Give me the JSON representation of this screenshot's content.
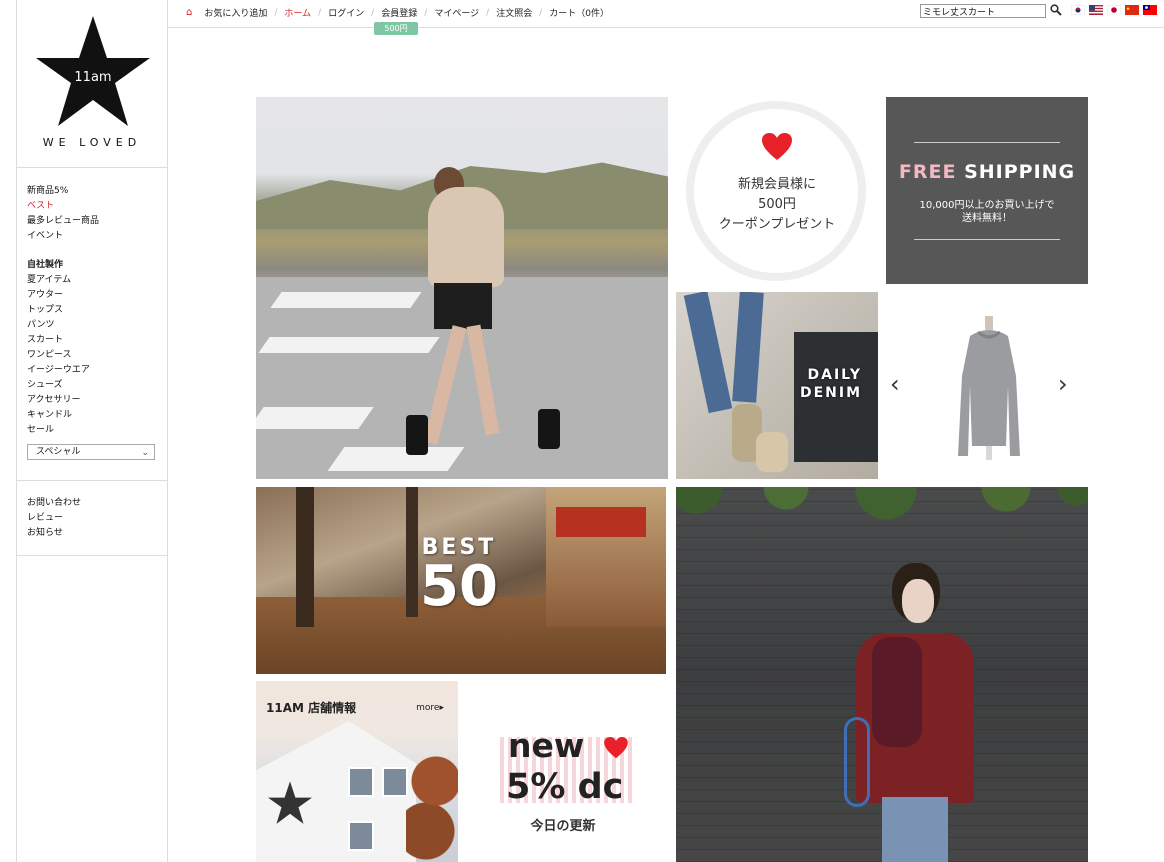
{
  "brand": {
    "logo_text": "11am",
    "tagline": "WE LOVED"
  },
  "sidebar": {
    "menu1": [
      "新商品5%",
      "ベスト",
      "最多レビュー商品",
      "イベント"
    ],
    "category_head": "自社製作",
    "categories": [
      "夏アイテム",
      "アウター",
      "トップス",
      "パンツ",
      "スカート",
      "ワンピース",
      "イージーウエア",
      "シューズ",
      "アクセサリー",
      "キャンドル",
      "セール"
    ],
    "select_value": "スペシャル",
    "menu2": [
      "お問い合わせ",
      "レビュー",
      "お知らせ"
    ]
  },
  "topbar": {
    "links": [
      "お気に入り追加",
      "ホーム",
      "ログイン",
      "会員登録",
      "マイページ",
      "注文照会",
      "カート（0件）"
    ],
    "badge": "500円",
    "search_value": "ミモレ丈スカート",
    "flags": [
      "korea-flag-icon",
      "usa-flag-icon",
      "japan-flag-icon",
      "china-flag-icon",
      "taiwan-flag-icon"
    ]
  },
  "tiles": {
    "coupon": {
      "line1": "新規会員様に",
      "line2": "500円",
      "line3": "クーポンプレゼント"
    },
    "shipping": {
      "title_free": "FREE",
      "title_rest": "SHIPPING",
      "line1": "10,000円以上のお買い上げで",
      "line2": "送料無料！"
    },
    "denim": {
      "line1": "DAILY",
      "line2": "DENIM"
    },
    "best": {
      "line1": "BEST",
      "line2": "50"
    },
    "shop": {
      "title": "11AM 店舗情報",
      "more": "more"
    },
    "new": {
      "line1": "new",
      "line2": "5% dc",
      "sub": "今日の更新"
    }
  },
  "colors": {
    "accent_red": "#d2232a",
    "badge_green": "#7fc7a4",
    "shipping_bg": "#575757",
    "shipping_pink": "#f4b8c0"
  }
}
